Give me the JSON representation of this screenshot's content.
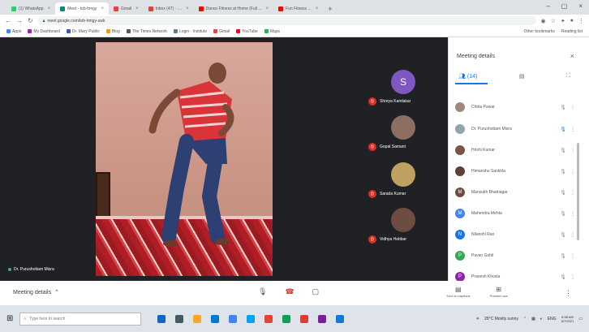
{
  "browser": {
    "tabs": [
      {
        "label": "(1) WhatsApp",
        "color": "#25d366"
      },
      {
        "label": "Meet - tob-hmgy",
        "color": "#00897b",
        "active": true
      },
      {
        "label": "Gmail",
        "color": "#ea4335"
      },
      {
        "label": "Inbox (47) - ....",
        "color": "#d44638"
      },
      {
        "label": "Dance Fitness at Home (Full ...",
        "color": "#ff0000"
      },
      {
        "label": "Fun Fitness ...",
        "color": "#ff0000"
      }
    ],
    "new_tab": "+",
    "url": "meet.google.com/tob-hmgy-uwk",
    "bookmarks": [
      {
        "label": "Apps",
        "color": "#4285f4"
      },
      {
        "label": "My Dashboard",
        "color": "#9c27b0"
      },
      {
        "label": "Dr. Mary Public",
        "color": "#3f51b5"
      },
      {
        "label": "Blog",
        "color": "#ff9800"
      },
      {
        "label": "The Times Network",
        "color": "#555555"
      },
      {
        "label": "Login - Institute",
        "color": "#607d8b"
      },
      {
        "label": "Gmail",
        "color": "#ea4335"
      },
      {
        "label": "YouTube",
        "color": "#ff0000"
      },
      {
        "label": "Maps",
        "color": "#34a853"
      }
    ],
    "bookmarks_right": [
      "Other bookmarks",
      "Reading list"
    ]
  },
  "stage": {
    "presenter_name": "Dr. Purushottam Misra",
    "tiles": [
      {
        "name": "Shreya Kamlakar",
        "initial": "S",
        "color": "#7e57c2"
      },
      {
        "name": "Gopal Samant",
        "initial": "",
        "color": "#8d6e63"
      },
      {
        "name": "Sarada Kumar",
        "initial": "",
        "color": "#c0a060"
      },
      {
        "name": "Vidhya Hebbar",
        "initial": "",
        "color": "#6d4c41"
      }
    ]
  },
  "panel": {
    "title": "Meeting details",
    "tabs": [
      {
        "label": "(14)",
        "icon": "people-icon"
      },
      {
        "label": "",
        "icon": "chat-icon"
      },
      {
        "label": "",
        "icon": "activities-icon"
      }
    ],
    "participants": [
      {
        "name": "Chitra Pawar",
        "initial": "",
        "color": "#a1887f"
      },
      {
        "name": "Dr. Purushottam Misra",
        "initial": "",
        "color": "#90a4ae"
      },
      {
        "name": "Hrishi Kumar",
        "initial": "",
        "color": "#795548"
      },
      {
        "name": "Himanshu Sankhla",
        "initial": "",
        "color": "#5d4037"
      },
      {
        "name": "Mansukh Bhatnagar",
        "initial": "M",
        "color": "#6d4c41"
      },
      {
        "name": "Mahendra Mehta",
        "initial": "M",
        "color": "#4285f4"
      },
      {
        "name": "Nilanshi Rao",
        "initial": "N",
        "color": "#1a73e8"
      },
      {
        "name": "Pavan Gohil",
        "initial": "P",
        "color": "#34a853"
      },
      {
        "name": "Pranesh Khosla",
        "initial": "P",
        "color": "#8e24aa"
      }
    ]
  },
  "bottom": {
    "meeting_details": "Meeting details",
    "actions": [
      {
        "label": "Turn on captions",
        "icon": "captions-icon"
      },
      {
        "label": "Present now",
        "icon": "present-icon"
      }
    ]
  },
  "taskbar": {
    "search_placeholder": "Type here to search",
    "weather": "28°C Mostly sunny",
    "lang": "ENG",
    "time": "6:58 AM",
    "date": "5/7/2021",
    "apps": [
      "#1565c0",
      "#455a64",
      "#f9a825",
      "#0078d4",
      "#4285f4",
      "#00a4ef",
      "#ea4335",
      "#0f9d58",
      "#e53935",
      "#7b1fa2",
      "#1976d2"
    ]
  }
}
